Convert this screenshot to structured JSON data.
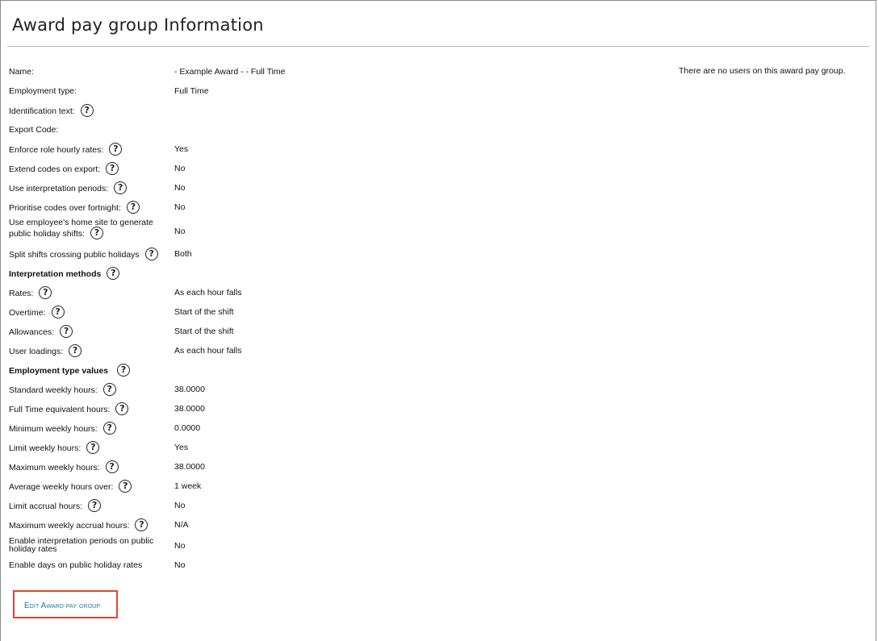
{
  "page": {
    "title": "Award pay group Information",
    "users_note": "There are no users on this award pay group.",
    "help_glyph": "?",
    "edit_label": "Edit Award pay group"
  },
  "rows": [
    {
      "label": "Name:",
      "value": "- Example Award - - Full Time"
    },
    {
      "label": "Employment type:",
      "value": "Full Time"
    },
    {
      "label": "Identification text:",
      "value": ""
    },
    {
      "label": "Export Code:",
      "value": ""
    },
    {
      "label": "Enforce role hourly rates:",
      "value": "Yes"
    },
    {
      "label": "Extend codes on export:",
      "value": "No"
    },
    {
      "label": "Use interpretation periods:",
      "value": "No"
    },
    {
      "label": "Prioritise codes over fortnight:",
      "value": "No"
    },
    {
      "label": "Use employee's home site to generate public holiday shifts:",
      "value": "No"
    },
    {
      "label": "Split shifts crossing public holidays",
      "value": "Both"
    },
    {
      "label": "Interpretation methods",
      "value": ""
    },
    {
      "label": "Rates:",
      "value": "As each hour falls"
    },
    {
      "label": "Overtime:",
      "value": "Start of the shift"
    },
    {
      "label": "Allowances:",
      "value": "Start of the shift"
    },
    {
      "label": "User loadings:",
      "value": "As each hour falls"
    },
    {
      "label": "Employment type values",
      "value": ""
    },
    {
      "label": "Standard weekly hours:",
      "value": "38.0000"
    },
    {
      "label": "Full Time equivalent hours:",
      "value": "38.0000"
    },
    {
      "label": "Minimum weekly hours:",
      "value": "0.0000"
    },
    {
      "label": "Limit weekly hours:",
      "value": "Yes"
    },
    {
      "label": "Maximum weekly hours:",
      "value": "38.0000"
    },
    {
      "label": "Average weekly hours over:",
      "value": "1 week"
    },
    {
      "label": "Limit accrual hours:",
      "value": "No"
    },
    {
      "label": "Maximum weekly accrual hours:",
      "value": "N/A"
    },
    {
      "label": "Enable interpretation periods on public holiday rates",
      "value": "No"
    },
    {
      "label": "Enable days on public holiday rates",
      "value": "No"
    }
  ]
}
